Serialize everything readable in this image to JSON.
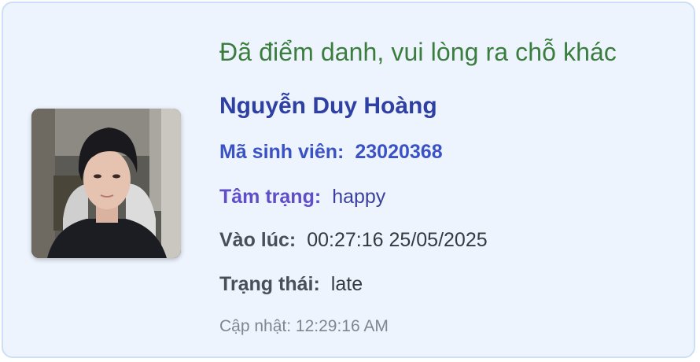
{
  "status_message": "Đã điểm danh, vui lòng ra chỗ khác",
  "student": {
    "name": "Nguyễn Duy Hoàng",
    "id_label": "Mã sinh viên:",
    "id_value": "23020368",
    "mood_label": "Tâm trạng:",
    "mood_value": "happy",
    "time_label": "Vào lúc:",
    "time_value": "00:27:16 25/05/2025",
    "state_label": "Trạng thái:",
    "state_value": "late"
  },
  "updated_text": "Cập nhật: 12:29:16 AM",
  "colors": {
    "card_bg": "#eef4fd",
    "card_border": "#cddff6",
    "status_green": "#3a7d3e",
    "name_blue": "#2f40a5",
    "id_blue": "#3a52c4",
    "mood_purple": "#5f4ec8",
    "muted_gray": "#80868e"
  }
}
